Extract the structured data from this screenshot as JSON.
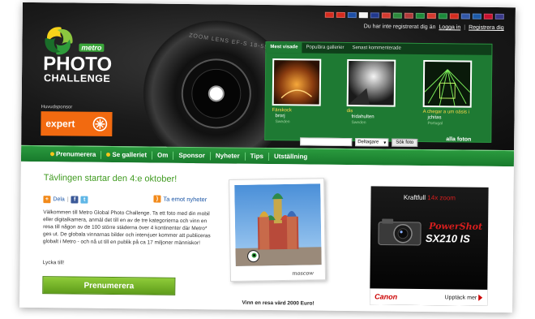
{
  "header": {
    "flags": [
      {
        "name": "canada",
        "color": "#d52b1e"
      },
      {
        "name": "canada",
        "color": "#d52b1e"
      },
      {
        "name": "czech",
        "color": "#1e4fa6"
      },
      {
        "name": "finland",
        "color": "#f4f4f4"
      },
      {
        "name": "uk",
        "color": "#20388e"
      },
      {
        "name": "italy",
        "color": "#d43a2f"
      },
      {
        "name": "hungary",
        "color": "#2c8a3c"
      },
      {
        "name": "usa",
        "color": "#b23a3a"
      },
      {
        "name": "portugal",
        "color": "#1e8a3a"
      },
      {
        "name": "italy",
        "color": "#d43a2f"
      },
      {
        "name": "mexico",
        "color": "#1a8a3a"
      },
      {
        "name": "chile",
        "color": "#d52b1e"
      },
      {
        "name": "russia",
        "color": "#3156a8"
      },
      {
        "name": "sweden",
        "color": "#1c5aa8"
      },
      {
        "name": "denmark",
        "color": "#c8102e"
      },
      {
        "name": "usa",
        "color": "#3a3a8a"
      }
    ],
    "login_prompt": "Du har inte registrerat dig än",
    "login_link": "Logga in",
    "register_link": "Registrera dig",
    "sponsor_label": "Huvudsponsor",
    "sponsor_name": "expert"
  },
  "logo": {
    "metro": "metro",
    "line1": "PHOTO",
    "line2": "CHALLENGE"
  },
  "lens_text": "ZOOM LENS EF-S 18-55mm 1:",
  "gallery": {
    "tabs": [
      "Mest visade",
      "Populära gallerier",
      "Senast kommenterade"
    ],
    "active_tab": 0,
    "items": [
      {
        "title": "Färskock",
        "user": "brorj",
        "country": "Sweden"
      },
      {
        "title": "dis",
        "user": "fridahulten",
        "country": "Sweden"
      },
      {
        "title": "A chegar a um oásis i",
        "user": "jchitas",
        "country": "Portugal"
      }
    ],
    "search_value": "",
    "search_select": "Deltagare",
    "search_button": "Sök foto",
    "all_photos": "alla foton"
  },
  "nav": [
    {
      "label": "Prenumerera",
      "dot": true
    },
    {
      "label": "Se galleriet",
      "dot": true
    },
    {
      "label": "Om",
      "dot": false
    },
    {
      "label": "Sponsor",
      "dot": false
    },
    {
      "label": "Nyheter",
      "dot": false
    },
    {
      "label": "Tips",
      "dot": false
    },
    {
      "label": "Utställning",
      "dot": false
    }
  ],
  "content": {
    "headline": "Tävlingen startar den 4:e oktober!",
    "share_label": "Dela",
    "rss_label": "Ta emot nyheter",
    "intro": "Välkommen till Metro Global Photo Challenge. Ta ett foto med din mobil eller digitalkamera, anmäl det till en av de tre kategorierna och vinn en resa till någon av de 100 större städerna över 4 kontinenter där Metro* ges ut. De globala vinnarnas bilder och intervjuer kommer att publiceras globalt i Metro - och nå ut till en publik på ca 17 miljoner människor!",
    "signoff": "Lycka till!",
    "subscribe_button": "Prenumerera",
    "polaroid_caption": "moscow",
    "prize_text": "Vinn en resa värd 2000 Euro!"
  },
  "ad": {
    "title_prefix": "Kraftfull",
    "title_highlight": "14x zoom",
    "brand": "PowerShot",
    "model": "SX210 IS",
    "maker": "Canon",
    "cta": "Upptäck mer",
    "accent_color": "#d81e1e"
  }
}
